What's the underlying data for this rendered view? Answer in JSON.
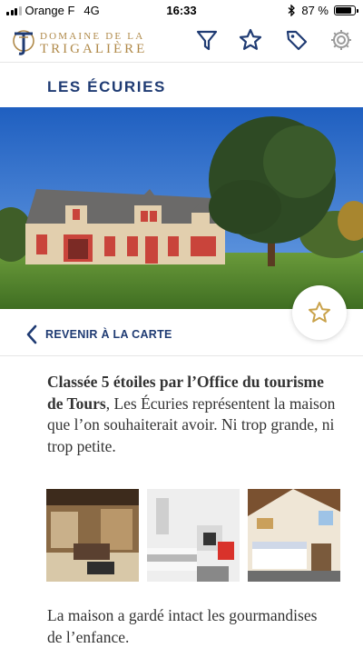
{
  "status_bar": {
    "carrier": "Orange F",
    "network": "4G",
    "time": "16:33",
    "battery": "87 %",
    "battery_level": 0.87
  },
  "header": {
    "logo_line1": "DOMAINE DE LA",
    "logo_line2": "TRIGALIÈRE",
    "icons": [
      "filter-icon",
      "star-icon",
      "tag-icon",
      "gear-icon"
    ],
    "accent_color": "#1f3b73",
    "gold_color": "#b08a4a"
  },
  "page": {
    "title": "LES ÉCURIES",
    "back_label": "REVENIR À LA CARTE"
  },
  "content": {
    "intro_bold": "Classée 5 étoiles par l’Office du tourisme de Tours",
    "intro_rest": ", Les Écuries représentent la maison que l’on souhaiterait avoir. Ni trop grande, ni trop petite.",
    "second_paragraph": "La maison a gardé intact les gourmandises de l’enfance."
  }
}
